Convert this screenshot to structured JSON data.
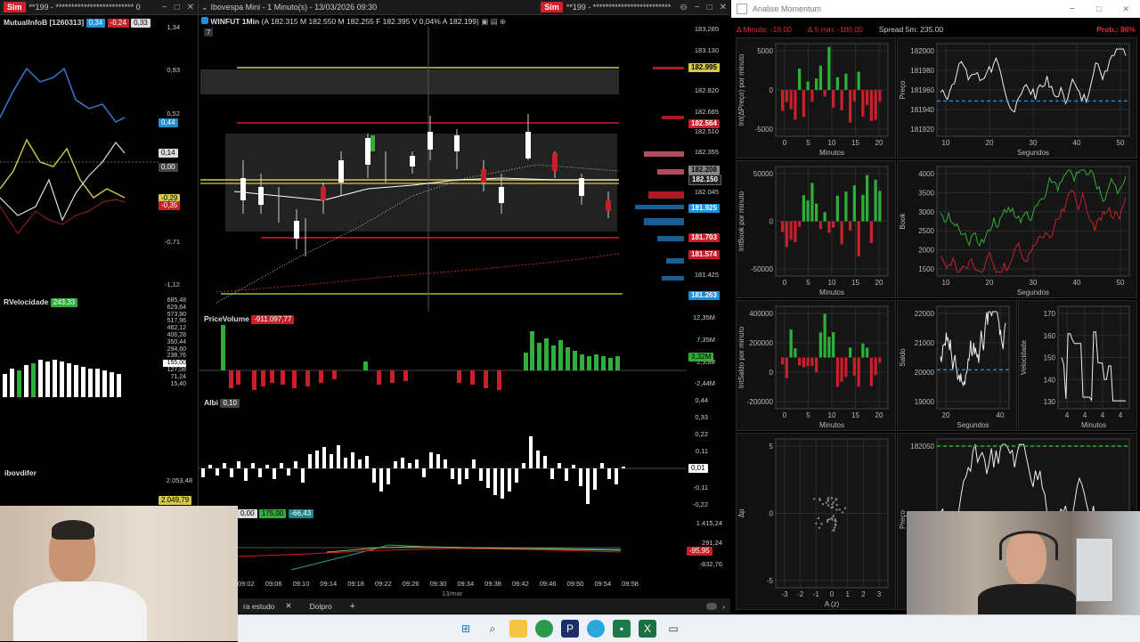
{
  "left_window": {
    "sim_label": "Sim",
    "title": "**199 - ************************* 0",
    "indicator_name": "MutualInfoB [1260313]",
    "tags": [
      "0,34",
      "-0,24",
      "0,33"
    ],
    "axis_top": [
      "1,34",
      "0,93",
      "0,52",
      "0,14",
      "0,00",
      "-0,29",
      "-0,35",
      "-0,71",
      "-1,12"
    ],
    "axis_tag_blue": "0,44",
    "velocidade_label": "RVelocidade",
    "velocidade_tag": "243,33",
    "axis_vel": [
      "685,48",
      "629,64",
      "573,80",
      "517,96",
      "462,12",
      "406,28",
      "350,44",
      "294,60",
      "238,76",
      "155,00",
      "127,08",
      "71,24",
      "15,40"
    ],
    "ibov_label": "ibovdifer",
    "ibov_axis": [
      "2.053,48",
      "2.049,79"
    ]
  },
  "main_window": {
    "sim_label": "Sim",
    "window_title": "Ibovespa Mini - 1 Minuto(s) - 13/03/2026 09:30",
    "title_right": "**199 - *************************",
    "chart_header": "WINFUT 1Min",
    "ohlc": "(A 182.315 M 182.550 M 182.255 F 182.395 V 0,04% A 182.199)",
    "period_badge": "7",
    "price_axis": [
      "183.285",
      "183.130",
      "182.820",
      "182.665",
      "182.510",
      "182.355",
      "182.045",
      "181.425"
    ],
    "price_tags": [
      {
        "text": "182.995",
        "color": "#d4c94a"
      },
      {
        "text": "182.564",
        "color": "#c8202a"
      },
      {
        "text": "182.208",
        "color": "#888888"
      },
      {
        "text": "182.150",
        "color": "#222222"
      },
      {
        "text": "181.925",
        "color": "#1e8fd6"
      },
      {
        "text": "181.703",
        "color": "#c8202a"
      },
      {
        "text": "181.574",
        "color": "#c8202a"
      },
      {
        "text": "181.263",
        "color": "#1e8fd6"
      }
    ],
    "pricevolume_label": "PriceVolume",
    "pricevolume_tag": "-911.097,77",
    "vol_axis": [
      "12,35M",
      "7,35M",
      "2,35M",
      "-2,44M"
    ],
    "vol_tag": "3,32M",
    "albi_label": "Albi",
    "albi_tag": "0,10",
    "albi_axis": [
      "0,44",
      "0,33",
      "0,22",
      "0,11",
      "-0,11",
      "-0,22"
    ],
    "albi_tag_right": "0,01",
    "bottom_tags": [
      "0,00",
      "175,00",
      "-66,43"
    ],
    "bottom_axis": [
      "1.415,24",
      "291,24",
      "-832,76"
    ],
    "bottom_tag_right": "-95,95",
    "time_axis": [
      "09:02",
      "09:06",
      "09:10",
      "09:14",
      "09:18",
      "09:22",
      "09:26",
      "09:30",
      "09:34",
      "09:38",
      "09:42",
      "09:46",
      "09:50",
      "09:54",
      "09:58"
    ],
    "date_label": "13/mar",
    "tabs": [
      "ra estudo",
      "Dolpro"
    ]
  },
  "momentum_window": {
    "title": "Analise Momentum",
    "stats": {
      "delta_min": "Δ Minuto: -10.00",
      "delta_5min": "Δ 5 min: -100.00",
      "spread": "Spread 5m: 235.00",
      "prob": "Prob.: 86%"
    },
    "plots": [
      {
        "ylabel": "Int(ΔPreço) por minuto",
        "xlabel": "Minutos",
        "yticks": [
          "5000",
          "0",
          "-5000"
        ],
        "xticks": [
          "0",
          "5",
          "10",
          "15",
          "20"
        ]
      },
      {
        "ylabel": "Preço",
        "xlabel": "Segundos",
        "yticks": [
          "182000",
          "181980",
          "181960",
          "181940",
          "181920"
        ],
        "xticks": [
          "10",
          "20",
          "30",
          "40",
          "50"
        ]
      },
      {
        "ylabel": "IntBook por minuto",
        "xlabel": "Minutos",
        "yticks": [
          "50000",
          "0",
          "-50000"
        ],
        "xticks": [
          "0",
          "5",
          "10",
          "15",
          "20"
        ]
      },
      {
        "ylabel": "Book",
        "xlabel": "Segundos",
        "yticks": [
          "4000",
          "3500",
          "3000",
          "2500",
          "2000",
          "1500"
        ],
        "xticks": [
          "10",
          "20",
          "30",
          "40",
          "50"
        ]
      },
      {
        "ylabel": "IntSaldo por minuto",
        "xlabel": "Minutos",
        "yticks": [
          "400000",
          "200000",
          "0",
          "-200000"
        ],
        "xticks": [
          "0",
          "5",
          "10",
          "15",
          "20"
        ]
      },
      {
        "ylabel": "Saldo",
        "xlabel": "Segundos",
        "yticks": [
          "22000",
          "21000",
          "20000",
          "19000"
        ],
        "xticks": [
          "20",
          "40"
        ]
      },
      {
        "ylabel": "Velocidade",
        "xlabel": "Minutos",
        "yticks": [
          "170",
          "160",
          "150",
          "140",
          "130"
        ],
        "xticks": [
          "4",
          "4",
          "4",
          "4"
        ]
      },
      {
        "ylabel": "Δp",
        "xlabel": "A (z)",
        "yticks": [
          "5",
          "0",
          "-5"
        ],
        "xticks": [
          "-3",
          "-2",
          "-1",
          "0",
          "1",
          "2",
          "3"
        ]
      },
      {
        "ylabel": "Preço",
        "xlabel": "",
        "yticks": [
          "182050",
          "182000"
        ],
        "xticks": []
      }
    ]
  },
  "colors": {
    "green": "#2fae3a",
    "red": "#c8202a",
    "yellow": "#d4c94a",
    "blue": "#1e8fd6"
  }
}
